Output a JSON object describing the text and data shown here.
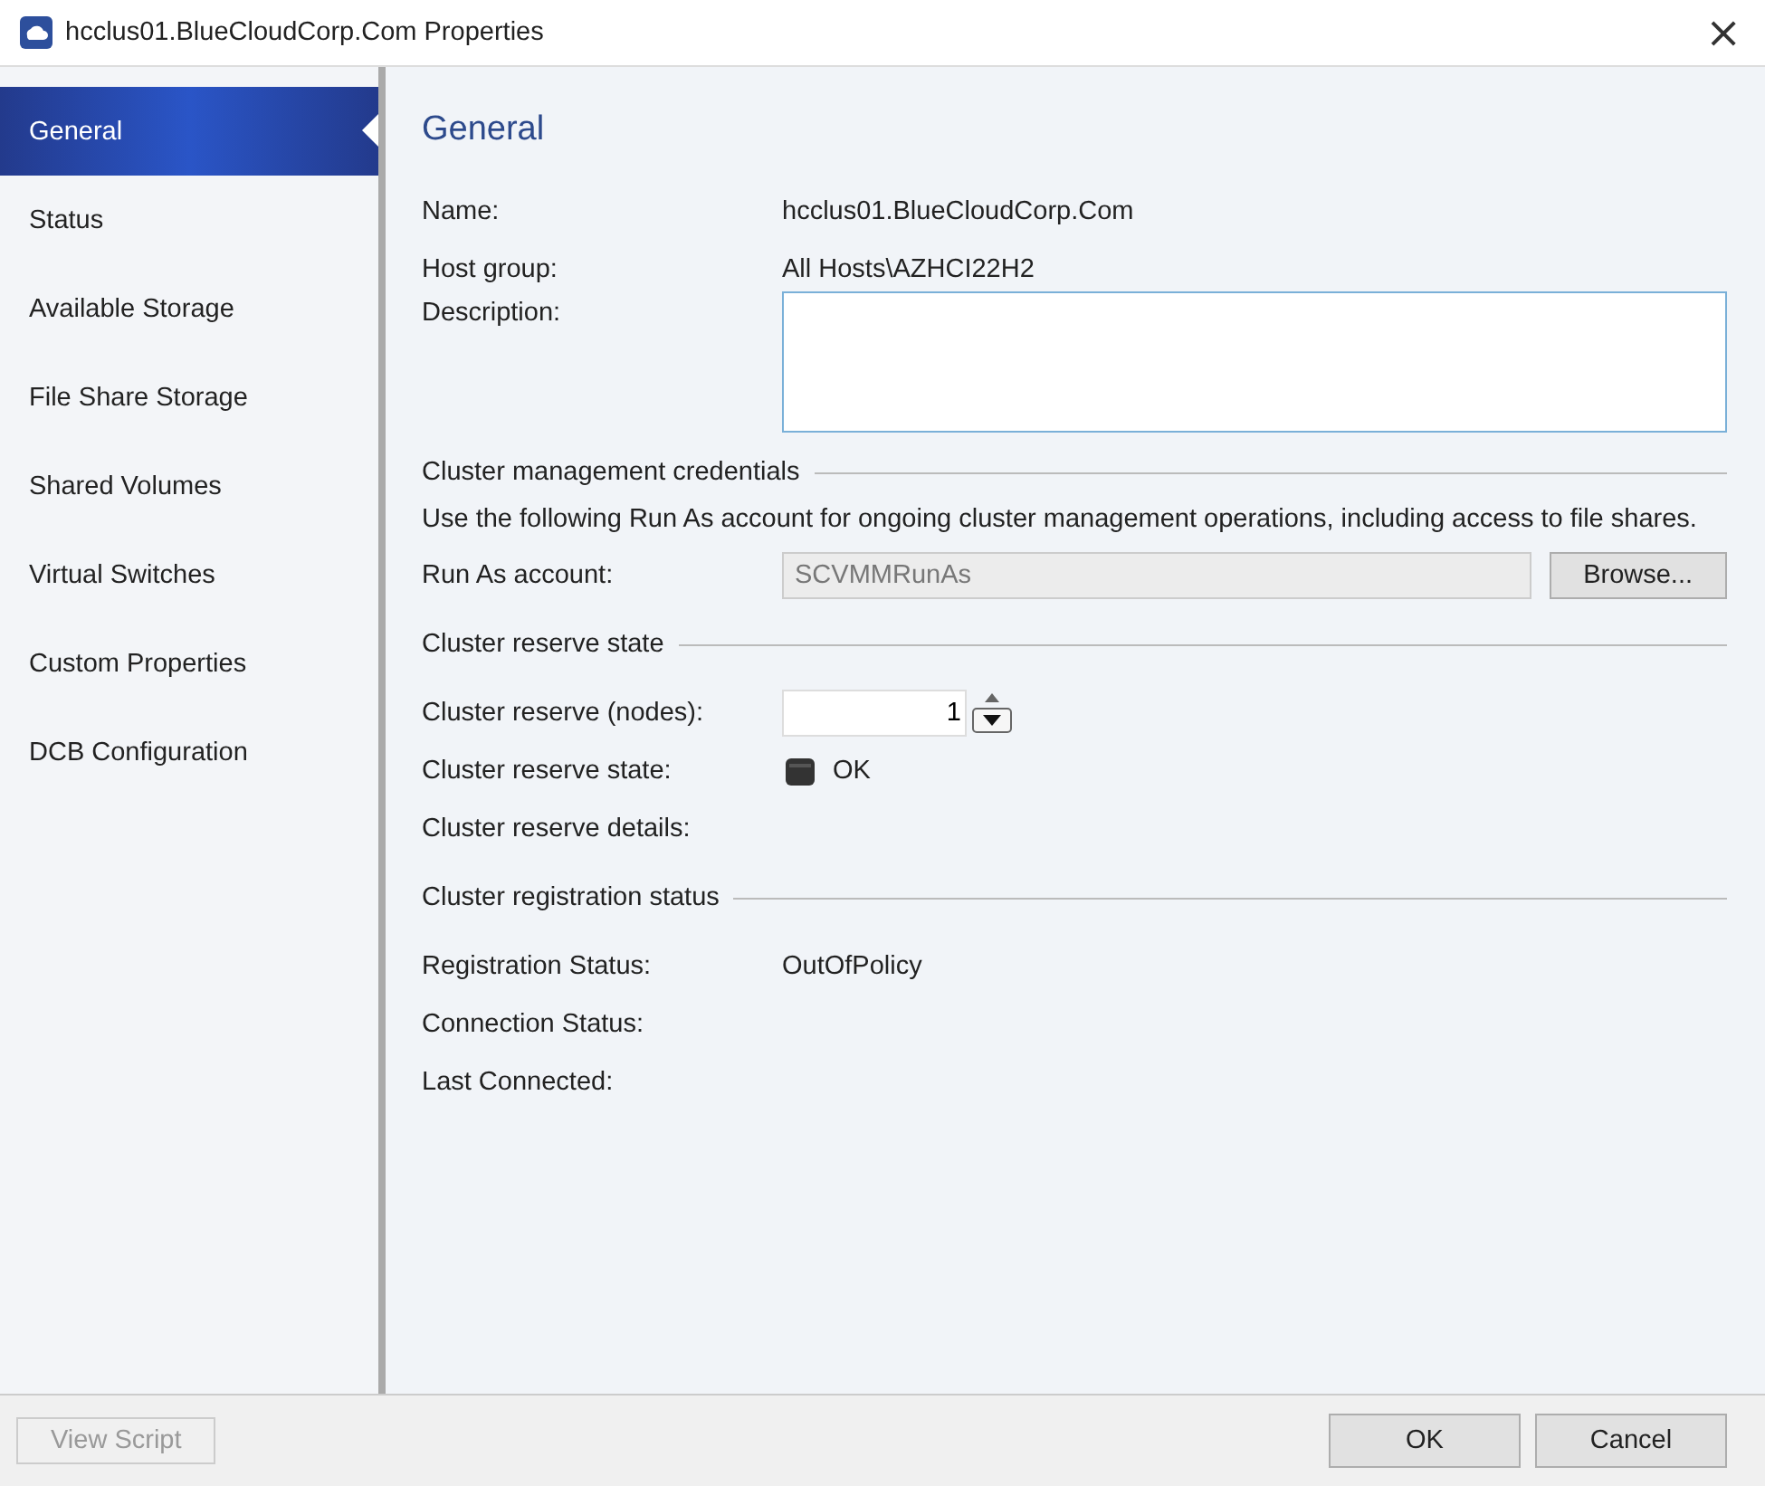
{
  "window": {
    "title": "hcclus01.BlueCloudCorp.Com Properties",
    "close": "×"
  },
  "sidebar": {
    "items": [
      {
        "label": "General",
        "selected": true
      },
      {
        "label": "Status",
        "selected": false
      },
      {
        "label": "Available Storage",
        "selected": false
      },
      {
        "label": "File Share Storage",
        "selected": false
      },
      {
        "label": "Shared Volumes",
        "selected": false
      },
      {
        "label": "Virtual Switches",
        "selected": false
      },
      {
        "label": "Custom Properties",
        "selected": false
      },
      {
        "label": "DCB Configuration",
        "selected": false
      }
    ]
  },
  "page": {
    "heading": "General",
    "name": {
      "label": "Name:",
      "value": "hcclus01.BlueCloudCorp.Com"
    },
    "host_group": {
      "label": "Host group:",
      "value": "All Hosts\\AZHCI22H2"
    },
    "description": {
      "label": "Description:"
    },
    "credentials": {
      "heading": "Cluster management credentials",
      "text": "Use the following Run As account for ongoing cluster management operations, including access to file shares.",
      "run_as_label": "Run As account:",
      "run_as_value": "SCVMMRunAs",
      "run_as_disabled": true,
      "browse": "Browse..."
    },
    "reserve": {
      "heading": "Cluster reserve state",
      "nodes_label": "Cluster reserve (nodes):",
      "nodes_value": "1",
      "state_label": "Cluster reserve state:",
      "state_value": "OK",
      "details_label": "Cluster reserve details:"
    },
    "registration": {
      "heading": "Cluster registration status",
      "rows": [
        {
          "label": "Registration Status:",
          "value": "OutOfPolicy"
        },
        {
          "label": "Connection Status:"
        },
        {
          "label": "Last Connected:"
        }
      ]
    }
  },
  "footer": {
    "view_script": {
      "label": "View Script",
      "disabled": true
    },
    "buttons": [
      "OK",
      "Cancel"
    ]
  }
}
